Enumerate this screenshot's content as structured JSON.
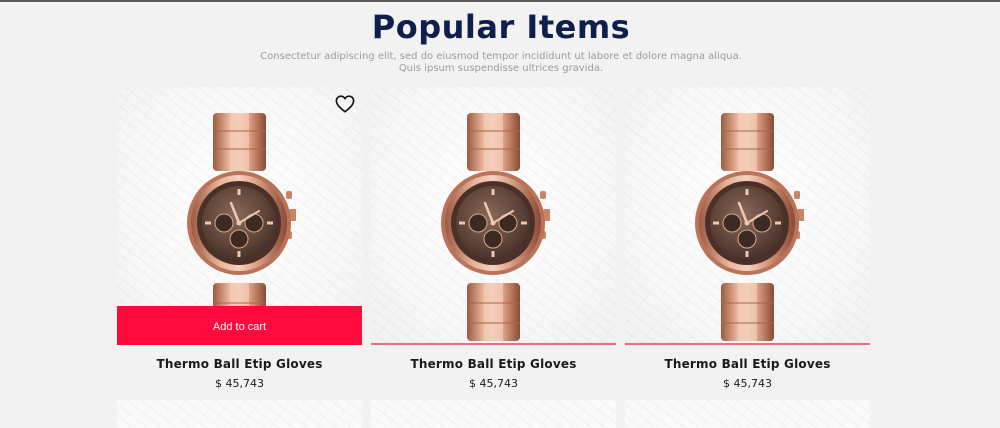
{
  "section": {
    "title": "Popular Items",
    "subtitle": "Consectetur adipiscing elit, sed do eiusmod tempor incididunt ut labore et dolore magna aliqua. Quis ipsum suspendisse ultrices gravida."
  },
  "products": [
    {
      "name": "Thermo Ball Etip Gloves",
      "price": "$ 45,743",
      "image_icon": "rose-gold-chronograph-watch",
      "wishlist_icon": "heart-outline-icon",
      "cta_label": "Add to cart"
    },
    {
      "name": "Thermo Ball Etip Gloves",
      "price": "$ 45,743",
      "image_icon": "rose-gold-chronograph-watch"
    },
    {
      "name": "Thermo Ball Etip Gloves",
      "price": "$ 45,743",
      "image_icon": "rose-gold-chronograph-watch"
    }
  ],
  "colors": {
    "title": "#0f1f4d",
    "cta_background": "#ff0a3c",
    "card_underline": "#f06a7e",
    "page_background": "#f2f2f2"
  }
}
